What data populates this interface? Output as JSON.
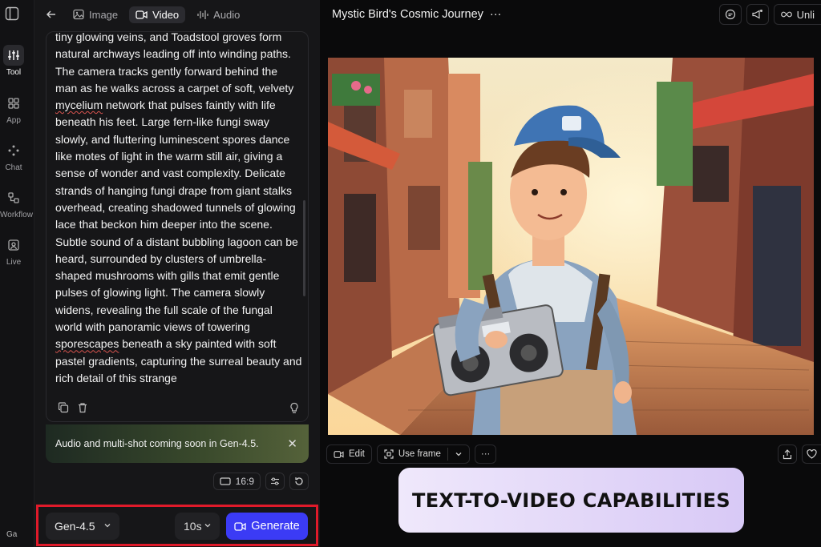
{
  "rail": {
    "items": [
      {
        "label": "Tool",
        "icon": "sliders-icon",
        "active": true
      },
      {
        "label": "App",
        "icon": "grid-icon"
      },
      {
        "label": "Chat",
        "icon": "sparkle-icon"
      },
      {
        "label": "Workflow",
        "icon": "workflow-icon"
      },
      {
        "label": "Live",
        "icon": "live-icon"
      }
    ],
    "bottom_label": "Ga"
  },
  "tabs": [
    {
      "label": "Image",
      "icon": "image-icon"
    },
    {
      "label": "Video",
      "icon": "video-icon",
      "active": true
    },
    {
      "label": "Audio",
      "icon": "audio-icon"
    }
  ],
  "prompt": {
    "seg1": "tiny glowing veins, and Toadstool groves form natural archways leading off into winding paths. The camera tracks gently forward behind the man as he walks across a carpet of soft, velvety ",
    "word1": "mycelium",
    "seg2": " network that pulses faintly with life beneath his feet. Large fern-like fungi sway slowly, and fluttering luminescent spores dance like motes of light in the warm still air, giving a sense of wonder and vast complexity. Delicate strands of hanging fungi drape from giant stalks overhead, creating shadowed tunnels of glowing lace that beckon him deeper into the scene. Subtle sound of a distant bubbling lagoon can be heard, surrounded by clusters of umbrella-shaped mushrooms with gills that emit gentle pulses of glowing light. The camera slowly widens, revealing the full scale of the fungal world with panoramic views of towering ",
    "word2": "sporescapes",
    "seg3": " beneath a sky painted with soft pastel gradients, capturing the surreal beauty and rich detail of this strange"
  },
  "notice": {
    "text": "Audio and multi-shot coming soon in Gen-4.5."
  },
  "aspect_ratio": "16:9",
  "generate_bar": {
    "model": "Gen-4.5",
    "duration": "10s",
    "generate_label": "Generate"
  },
  "project": {
    "title": "Mystic Bird's Cosmic Journey",
    "more": "···"
  },
  "top_actions": {
    "unlimited_label": "Unli"
  },
  "video_toolbar": {
    "edit_label": "Edit",
    "use_frame_label": "Use frame",
    "more": "···"
  },
  "caption": "TEXT-TO-VIDEO CAPABILITIES",
  "colors": {
    "accent": "#3b3bf5",
    "highlight_border": "#e01a2a",
    "caption_bg": "#e4d9f8"
  }
}
